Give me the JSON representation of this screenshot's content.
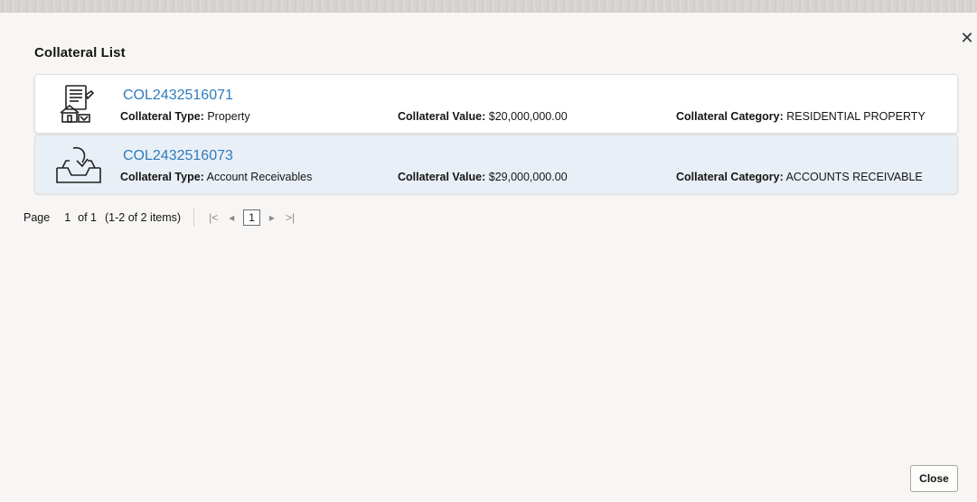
{
  "dialog": {
    "title": "Collateral List",
    "close_icon": "close-icon",
    "close_button_label": "Close"
  },
  "labels": {
    "type": "Collateral Type:",
    "value": "Collateral Value:",
    "category": "Collateral Category:"
  },
  "collaterals": [
    {
      "id": "COL2432516071",
      "icon": "property-document-icon",
      "type": "Property",
      "value": "$20,000,000.00",
      "category": "RESIDENTIAL PROPERTY"
    },
    {
      "id": "COL2432516073",
      "icon": "account-receivables-icon",
      "type": "Account Receivables",
      "value": "$29,000,000.00",
      "category": "ACCOUNTS RECEIVABLE"
    }
  ],
  "pagination": {
    "page_label": "Page",
    "current_page": "1",
    "of_text": "of 1",
    "items_text": "(1-2 of 2 items)",
    "first_icon": "|<",
    "prev_icon": "◂",
    "page_button": "1",
    "next_icon": "▸",
    "last_icon": ">|"
  }
}
